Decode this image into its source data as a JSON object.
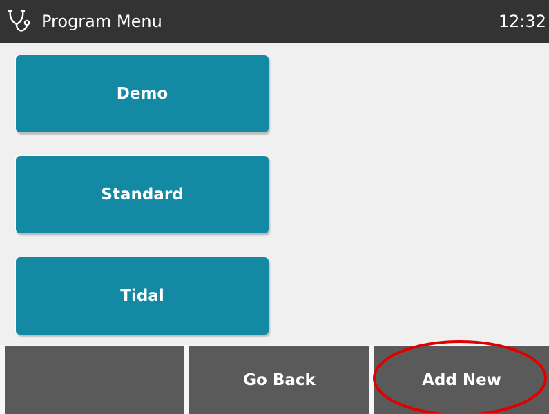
{
  "header": {
    "title": "Program Menu",
    "time": "12:32",
    "icon": "stethoscope-icon"
  },
  "programs": [
    {
      "label": "Demo"
    },
    {
      "label": "Standard"
    },
    {
      "label": "Tidal"
    }
  ],
  "softkeys": [
    {
      "label": ""
    },
    {
      "label": "Go Back"
    },
    {
      "label": "Add New"
    }
  ],
  "colors": {
    "title_bar": "#333333",
    "program_button": "#1489a4",
    "softkey": "#5a5a5a",
    "background": "#f0f0f0",
    "highlight": "#e00000"
  }
}
